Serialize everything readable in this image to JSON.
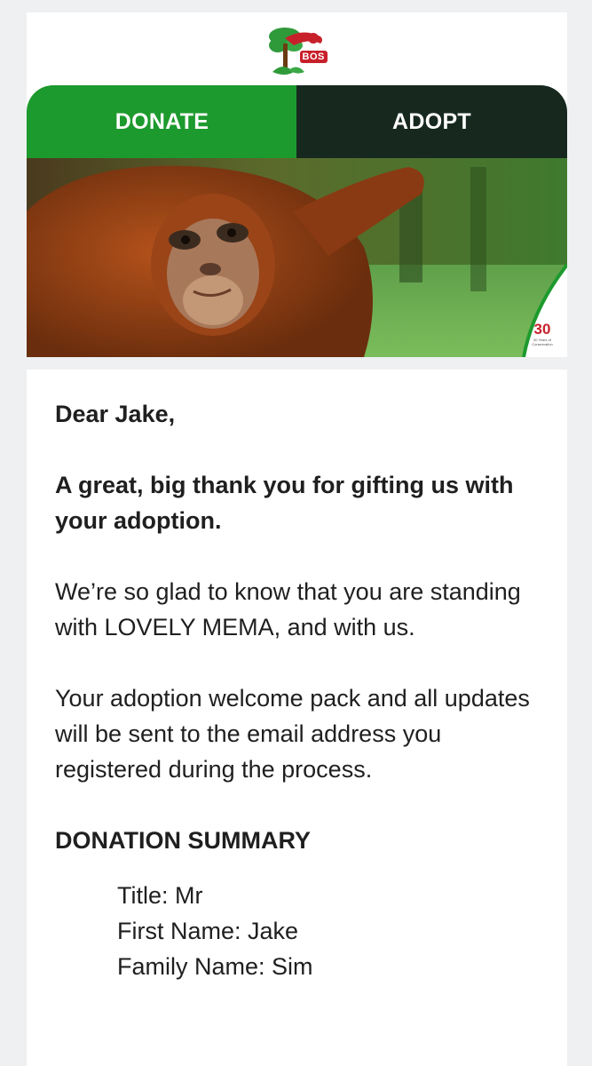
{
  "header": {
    "logo_text": "BOS",
    "tabs": [
      {
        "label": "DONATE"
      },
      {
        "label": "ADOPT"
      }
    ],
    "badge_text": "30",
    "badge_subtext": "30 Years of Conservation"
  },
  "colors": {
    "donate_green": "#1d9a2e",
    "adopt_dark": "#17291f",
    "brand_red": "#c8202b"
  },
  "email": {
    "greeting": "Dear Jake,",
    "thanks": "A great, big thank you for gifting us with your adoption.",
    "paragraph_1": "We’re so glad to know that you are standing with LOVELY MEMA, and with us.",
    "paragraph_2": "Your adoption welcome pack and all updates will be sent to the email address you registered during the process.",
    "summary_title": "DONATION SUMMARY",
    "summary_items": [
      {
        "text": "Title: Mr"
      },
      {
        "text": "First Name: Jake"
      },
      {
        "text": "Family Name: Sim"
      }
    ]
  }
}
